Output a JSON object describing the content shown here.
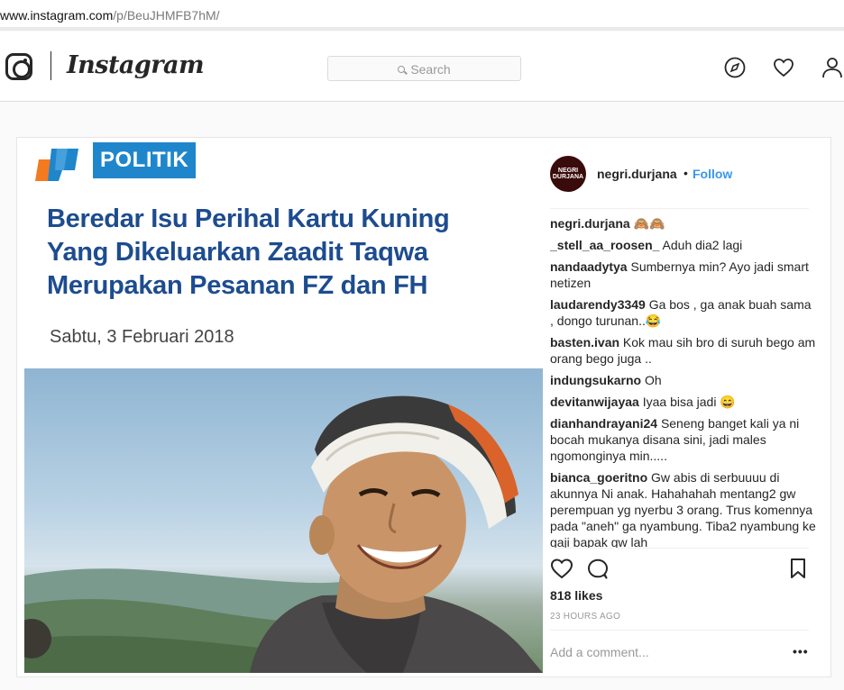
{
  "browser": {
    "url_host": "www.instagram.com",
    "url_path": "/p/BeuJHMFB7hM/"
  },
  "header": {
    "wordmark": "Instagram",
    "search_placeholder": "Search",
    "icons": [
      "instagram-glyph-icon",
      "compass-icon",
      "heart-icon",
      "person-icon"
    ]
  },
  "post": {
    "image": {
      "tag": "POLITIK",
      "headline_lines": [
        "Beredar Isu Perihal Kartu Kuning",
        "Yang Dikeluarkan Zaadit Taqwa",
        "Merupakan Pesanan FZ dan FH"
      ],
      "date": "Sabtu, 3 Februari 2018"
    },
    "author": {
      "username": "negri.durjana",
      "separator": "•",
      "follow_label": "Follow",
      "avatar_text": "NEGRI DURJANA"
    },
    "comments": [
      {
        "user": "negri.durjana",
        "text": "🙈🙈"
      },
      {
        "user": "_stell_aa_roosen_",
        "text": "Aduh dia2 lagi"
      },
      {
        "user": "nandaadytya",
        "text": "Sumbernya min? Ayo jadi smart netizen"
      },
      {
        "user": "laudarendy3349",
        "text": "Ga bos , ga anak buah sama , dongo turunan..😂"
      },
      {
        "user": "basten.ivan",
        "text": "Kok mau sih bro di suruh bego am orang bego juga .."
      },
      {
        "user": "indungsukarno",
        "text": "Oh"
      },
      {
        "user": "devitanwijayaa",
        "text": "Iyaa bisa jadi 😄"
      },
      {
        "user": "dianhandrayani24",
        "text": "Seneng banget kali ya ni bocah mukanya disana sini, jadi males ngomonginya min....."
      },
      {
        "user": "bianca_goeritno",
        "text": "Gw abis di serbuuuu di akunnya Ni anak. Hahahahah mentang2 gw perempuan yg nyerbu 3 orang. Trus komennya pada \"aneh\" ga nyambung. Tiba2 nyambung ke gaji bapak gw lah"
      }
    ],
    "likes": "818 likes",
    "time": "23 HOURS AGO",
    "add_comment_placeholder": "Add a comment...",
    "more_label": "•••",
    "colors": {
      "follow": "#3897f0",
      "headline": "#1d4c8f",
      "tag_bg": "#1f86cc"
    }
  }
}
